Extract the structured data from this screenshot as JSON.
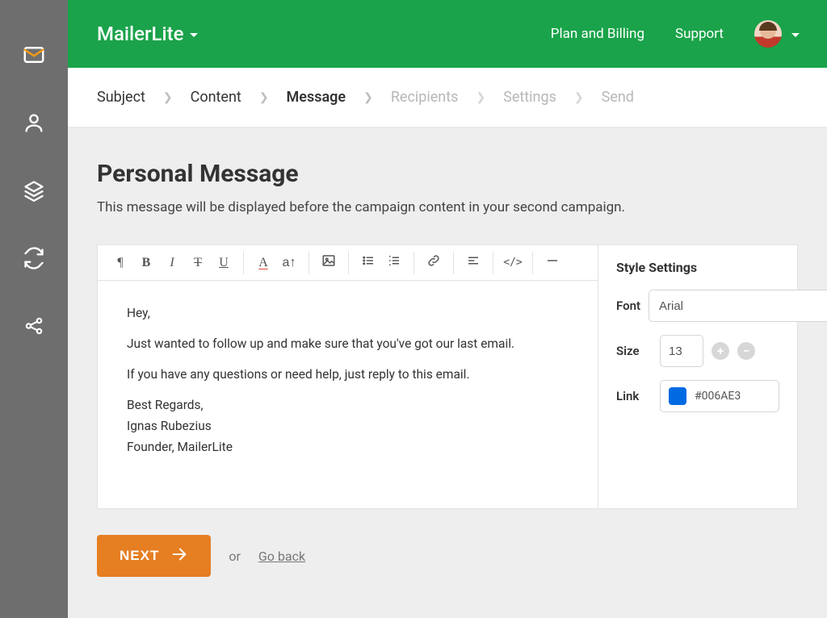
{
  "brand": "MailerLite",
  "top_nav": {
    "plan_billing": "Plan and Billing",
    "support": "Support"
  },
  "breadcrumb": [
    {
      "label": "Subject",
      "state": "done"
    },
    {
      "label": "Content",
      "state": "done"
    },
    {
      "label": "Message",
      "state": "active"
    },
    {
      "label": "Recipients",
      "state": "disabled"
    },
    {
      "label": "Settings",
      "state": "disabled"
    },
    {
      "label": "Send",
      "state": "disabled"
    }
  ],
  "page": {
    "title": "Personal Message",
    "description": "This message will be displayed before the campaign content in your second campaign."
  },
  "editor": {
    "lines": {
      "l1": "Hey,",
      "l2": "Just wanted to follow up and make sure that you've got our last email.",
      "l3": "If you have any questions or need help, just reply to this email.",
      "s1": "Best Regards,",
      "s2": "Ignas Rubezius",
      "s3": "Founder, MailerLite"
    }
  },
  "style_settings": {
    "title": "Style Settings",
    "font_label": "Font",
    "font_value": "Arial",
    "size_label": "Size",
    "size_value": "13",
    "link_label": "Link",
    "link_color_hex": "#006AE3"
  },
  "footer": {
    "next": "NEXT",
    "or": "or",
    "go_back": "Go back"
  },
  "toolbar": {
    "pilcrow": "¶",
    "bold": "B",
    "italic": "I",
    "strike": "T",
    "underline": "U",
    "fontcolor": "A",
    "fontsize": "a↑",
    "code": "</>"
  }
}
